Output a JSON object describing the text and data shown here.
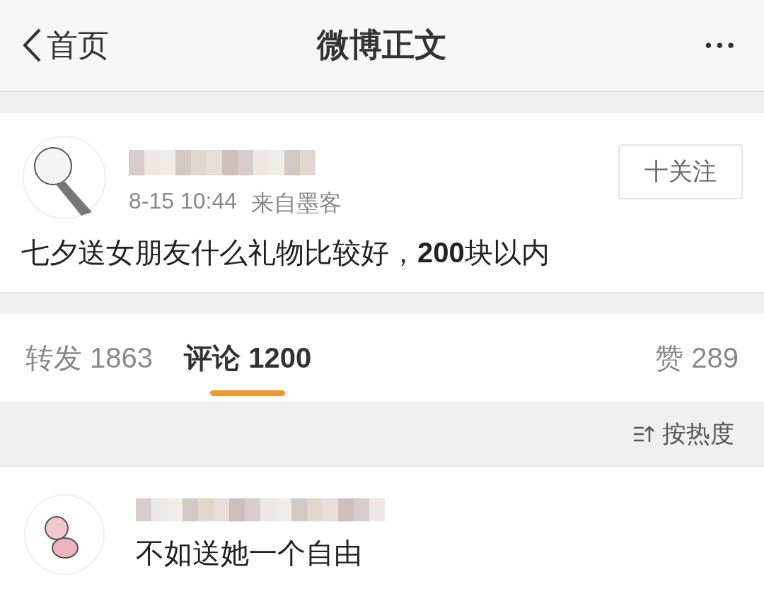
{
  "nav_bar": {
    "back_label": "首页",
    "title": "微博正文",
    "more": "•••"
  },
  "post": {
    "timestamp": "8-15 10:44",
    "source": "来自墨客",
    "follow_button": "十关注",
    "text": "七夕送女朋友什么礼物比较好，**200**块以内"
  },
  "tabs": [
    {
      "label": "转发 1863",
      "selected": false
    },
    {
      "label": "评论 1200",
      "selected": true
    },
    {
      "label": "赞 289",
      "selected": false
    }
  ],
  "sort": {
    "label": "按热度"
  },
  "comments": [
    {
      "text": "不如送她一个自由"
    }
  ]
}
